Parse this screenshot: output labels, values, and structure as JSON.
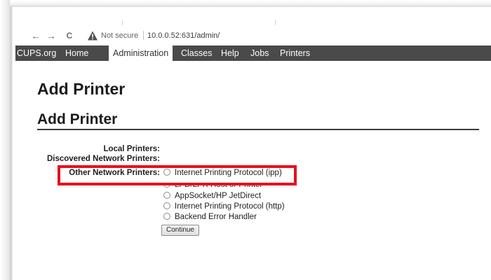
{
  "browser": {
    "back_glyph": "←",
    "forward_glyph": "→",
    "reload_glyph": "C",
    "security_text": "Not secure",
    "url": "10.0.0.52:631/admin/",
    "icons": [
      "back-arrow-icon",
      "forward-arrow-icon",
      "reload-icon",
      "warning-triangle-icon"
    ]
  },
  "navbar": {
    "items": [
      "CUPS.org",
      "Home",
      "Administration",
      "Classes",
      "Help",
      "Jobs",
      "Printers"
    ],
    "active": "Administration"
  },
  "page": {
    "title": "Add Printer",
    "section_title": "Add Printer"
  },
  "form": {
    "local_printers_label": "Local Printers:",
    "discovered_label": "Discovered Network Printers:",
    "other_label": "Other Network Printers:",
    "options": [
      "Internet Printing Protocol (ipp)",
      "LPD/LPR Host or Printer",
      "AppSocket/HP JetDirect",
      "Internet Printing Protocol (http)",
      "Backend Error Handler"
    ],
    "continue_label": "Continue"
  },
  "colors": {
    "navbar_bg": "#4a4a4a",
    "highlight_border": "#e8101e"
  }
}
